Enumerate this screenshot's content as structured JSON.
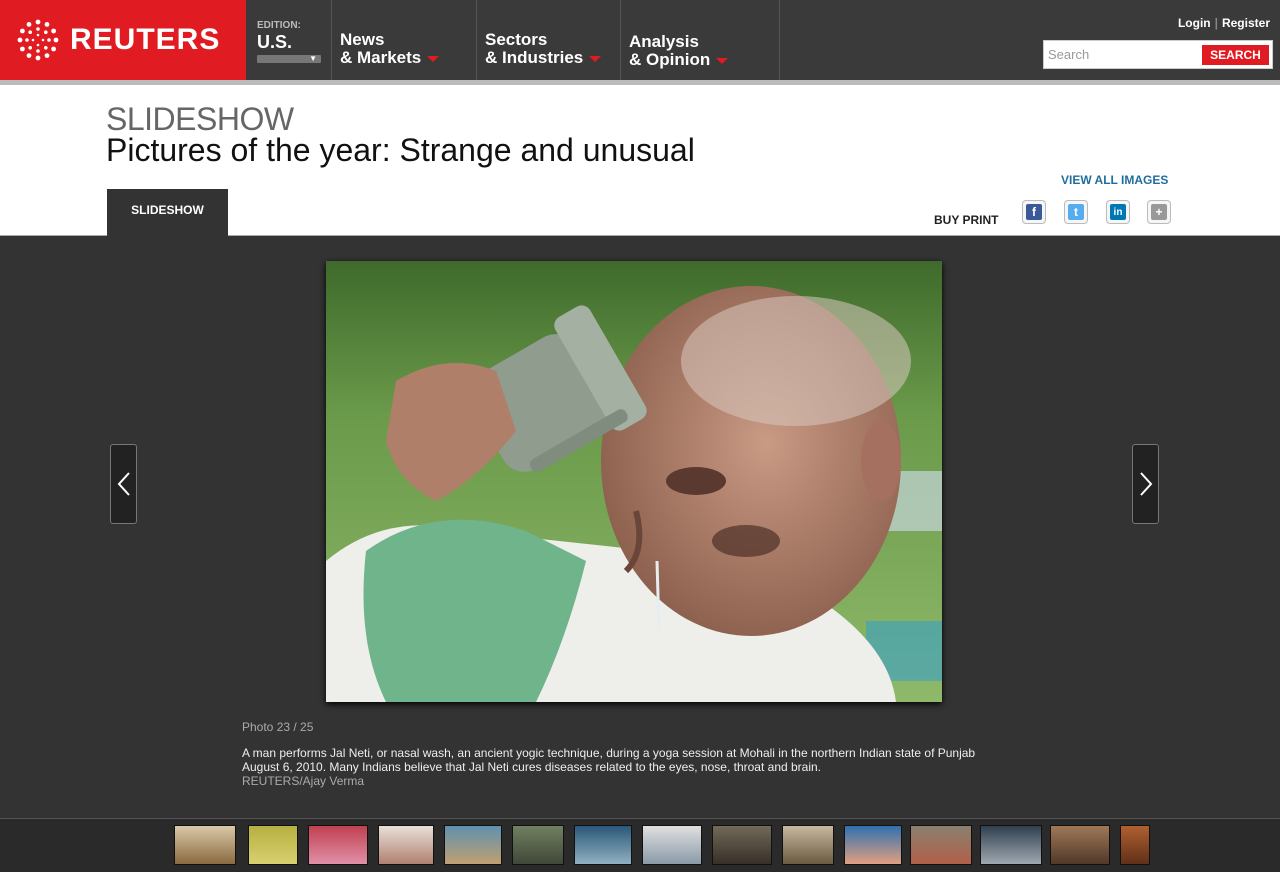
{
  "brand": {
    "name": "REUTERS",
    "accent": "#e11b22"
  },
  "edition": {
    "label": "EDITION:",
    "value": "U.S."
  },
  "nav": [
    {
      "line1": "News",
      "line2": "& Markets"
    },
    {
      "line1": "Sectors",
      "line2": "& Industries"
    },
    {
      "line1": "Analysis",
      "line2": "& Opinion"
    }
  ],
  "auth": {
    "login": "Login",
    "register": "Register"
  },
  "search": {
    "placeholder": "Search",
    "button": "SEARCH"
  },
  "header": {
    "kicker": "SLIDESHOW",
    "title": "Pictures of the year: Strange and unusual",
    "tab": "SLIDESHOW",
    "view_all": "VIEW ALL IMAGES",
    "buy_print": "BUY PRINT"
  },
  "share": [
    {
      "name": "facebook-icon",
      "glyph": "f",
      "color": "#3b5998"
    },
    {
      "name": "twitter-icon",
      "glyph": "t",
      "color": "#55acee"
    },
    {
      "name": "linkedin-icon",
      "glyph": "in",
      "color": "#0077b5"
    },
    {
      "name": "share-more-icon",
      "glyph": "+",
      "color": "#999999"
    }
  ],
  "slide": {
    "counter": "Photo  23 / 25",
    "caption": "A man performs Jal Neti, or nasal wash, an ancient yogic technique, during a yoga session at Mohali in the northern Indian state of Punjab August 6, 2010. Many Indians believe that Jal Neti cures diseases related to the eyes, nose, throat and brain.",
    "credit": "REUTERS/Ajay Verma",
    "prev_icon": "chevron-left-icon",
    "next_icon": "chevron-right-icon"
  },
  "thumbnails_count": 15
}
